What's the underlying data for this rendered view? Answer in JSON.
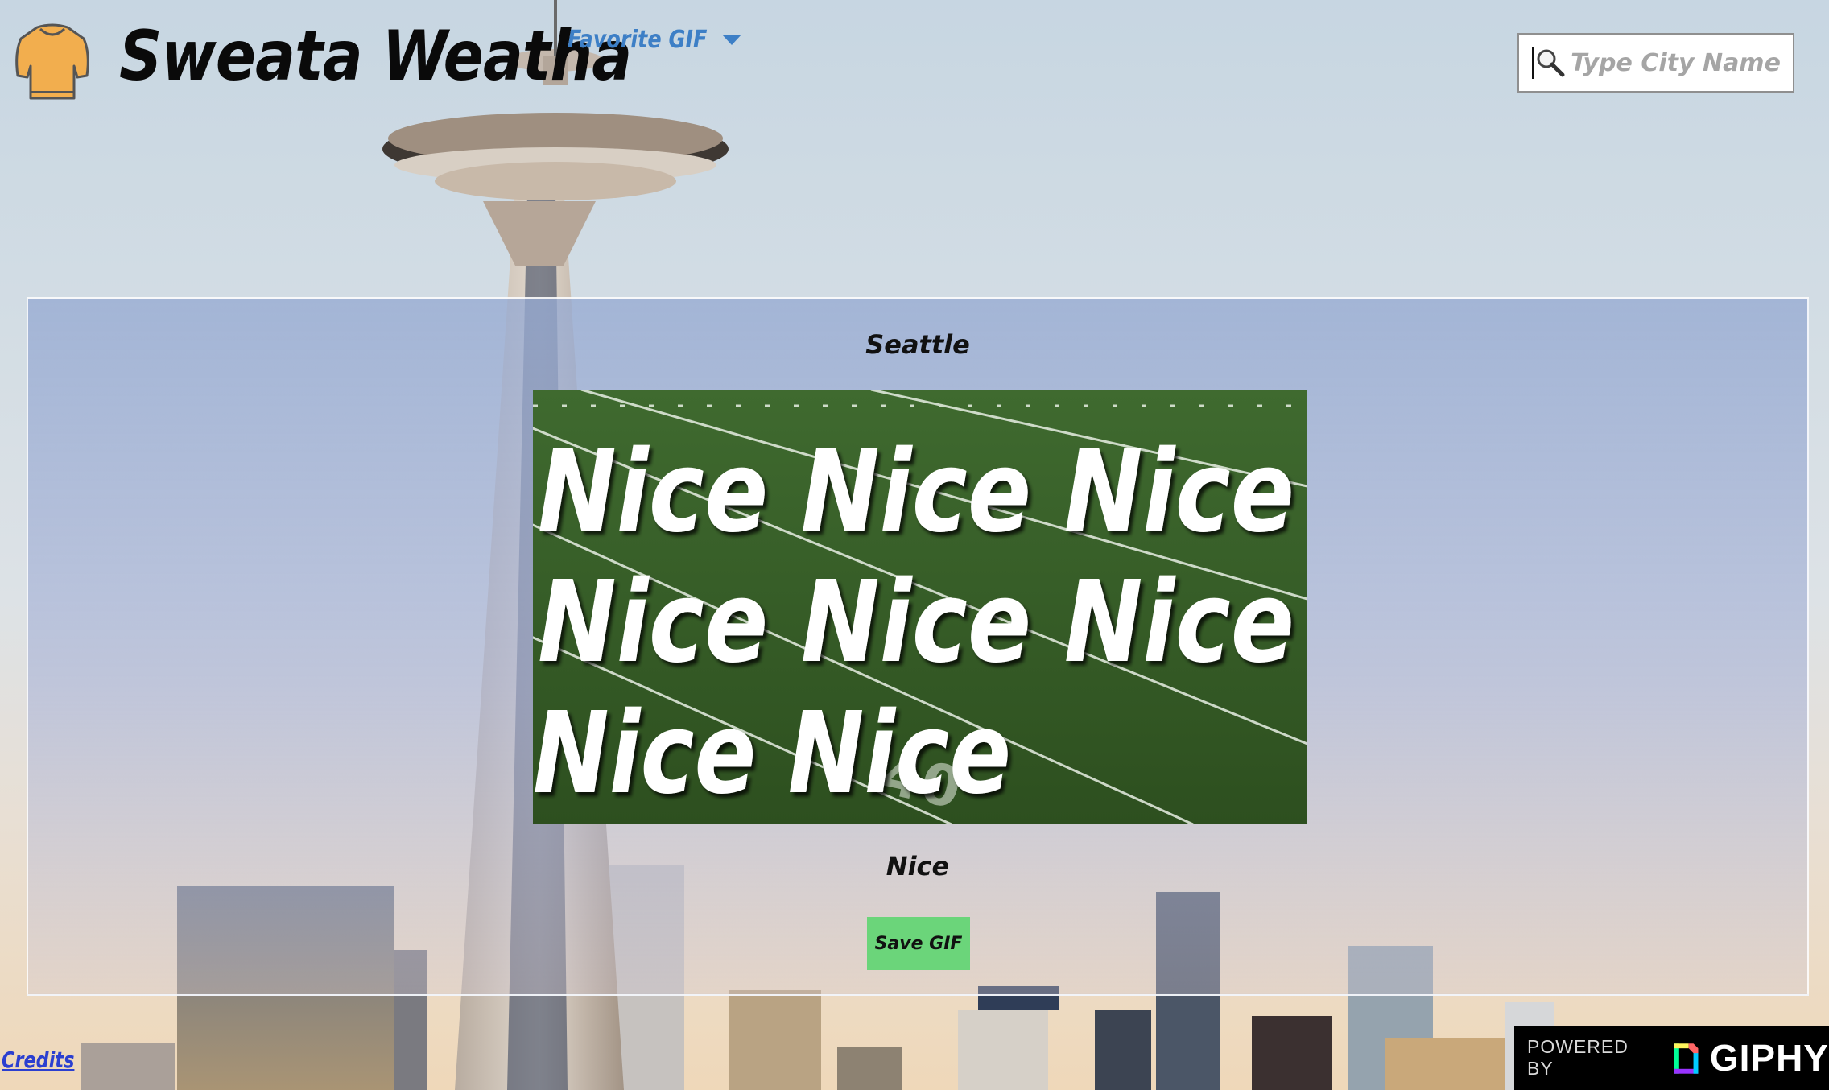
{
  "header": {
    "brand": "Sweata Weatha",
    "favorite_label": "Favorite GIF",
    "search_placeholder": "Type City Name"
  },
  "main": {
    "city": "Seattle",
    "gif": {
      "lines": [
        "Nice Nice Nice",
        "Nice Nice Nice",
        "Nice Nice"
      ],
      "title": "Nice"
    },
    "save_label": "Save GIF"
  },
  "footer": {
    "credits_label": "Credits",
    "giphy_prefix": "POWERED BY",
    "giphy_brand": "GIPHY"
  },
  "colors": {
    "accent_blue": "#3d7fc6",
    "save_green": "#6bd57a",
    "sweater_orange": "#f2ae4e"
  },
  "icons": [
    "sweater-icon",
    "chevron-down-icon",
    "search-icon",
    "giphy-logo-icon"
  ]
}
